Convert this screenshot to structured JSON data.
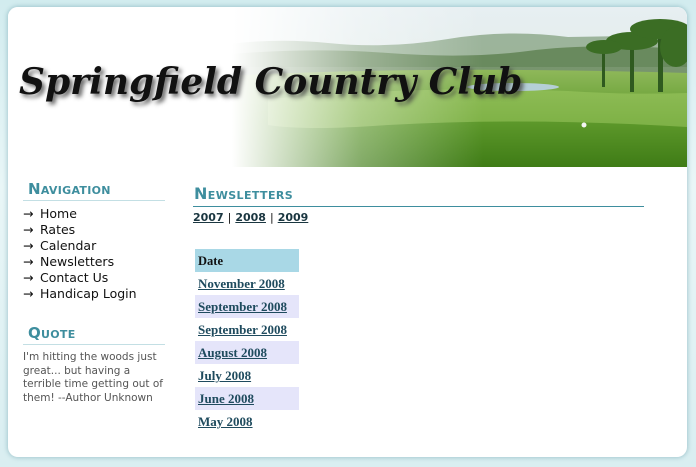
{
  "site": {
    "title": "Springfield Country Club"
  },
  "colors": {
    "accent": "#3e8e9e",
    "table_header_bg": "#a9d8e6",
    "row_alt_bg": "#e5e5fa",
    "link": "#1f4b5e"
  },
  "sidebar": {
    "navigation_heading": "Navigation",
    "nav_items": [
      {
        "label": "Home",
        "icon": "arrow-right-icon"
      },
      {
        "label": "Rates",
        "icon": "arrow-right-icon"
      },
      {
        "label": "Calendar",
        "icon": "arrow-right-icon"
      },
      {
        "label": "Newsletters",
        "icon": "arrow-right-icon"
      },
      {
        "label": "Contact Us",
        "icon": "arrow-right-icon"
      },
      {
        "label": "Handicap Login",
        "icon": "arrow-right-icon"
      }
    ],
    "quote_heading": "Quote",
    "quote_text": "I'm hitting the woods just great... but having a terrible time getting out of them! --Author Unknown"
  },
  "main": {
    "page_title": "Newsletters",
    "years": [
      "2007",
      "2008",
      "2009"
    ],
    "year_separator": "|",
    "table": {
      "header": "Date",
      "rows": [
        "November 2008",
        "September 2008",
        "September 2008",
        "August 2008",
        "July 2008",
        "June 2008",
        "May 2008"
      ]
    }
  }
}
